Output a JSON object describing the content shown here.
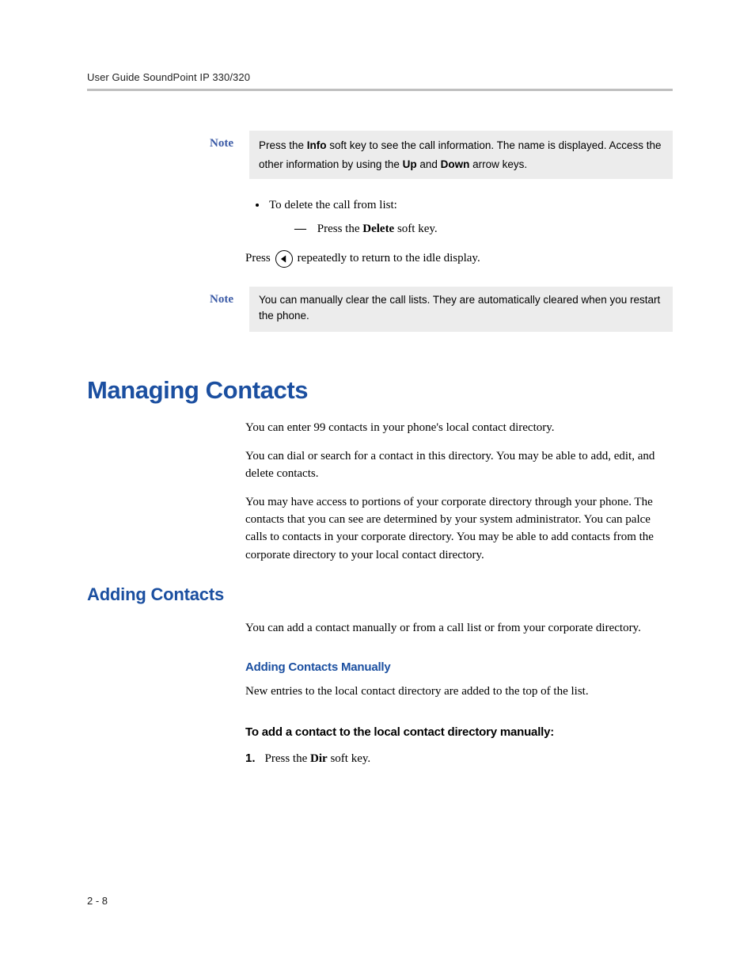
{
  "header": {
    "running": "User Guide SoundPoint IP 330/320"
  },
  "note1": {
    "label": "Note",
    "body_parts": {
      "pre1": "Press the ",
      "b1": "Info",
      "mid1": " soft key to see the call information. The name is displayed. Access the other information by using the ",
      "b2": "Up",
      "mid2": " and ",
      "b3": "Down",
      "post": " arrow keys."
    }
  },
  "delete_block": {
    "bullet": "To delete the call from list:",
    "dash_pre": "Press the ",
    "dash_b": "Delete",
    "dash_post": " soft key.",
    "press_pre": "Press ",
    "press_post": " repeatedly to return to the idle display."
  },
  "note2": {
    "label": "Note",
    "body": "You can manually clear the call lists. They are automatically cleared when you restart the phone."
  },
  "h1": "Managing Contacts",
  "paras": {
    "p1": "You can enter 99 contacts in your phone's local contact directory.",
    "p2": "You can dial or search for a contact in this directory. You may be able to add, edit, and delete contacts.",
    "p3": "You may have access to portions of your corporate directory through your phone. The contacts that you can see are determined by your system administrator. You can palce calls to contacts in your corporate directory. You may be able to add contacts from the corporate directory to your local contact directory."
  },
  "h2": "Adding Contacts",
  "p_adding": "You can add a contact manually or from a call list or from your corporate directory.",
  "h3_manual": "Adding Contacts Manually",
  "p_manual": "New entries to the local contact directory are added to the top of the list.",
  "steps_title": "To add a contact to the local contact directory manually:",
  "step1": {
    "num": "1.",
    "pre": "Press the ",
    "b": "Dir",
    "post": " soft key."
  },
  "page_num": "2 - 8"
}
